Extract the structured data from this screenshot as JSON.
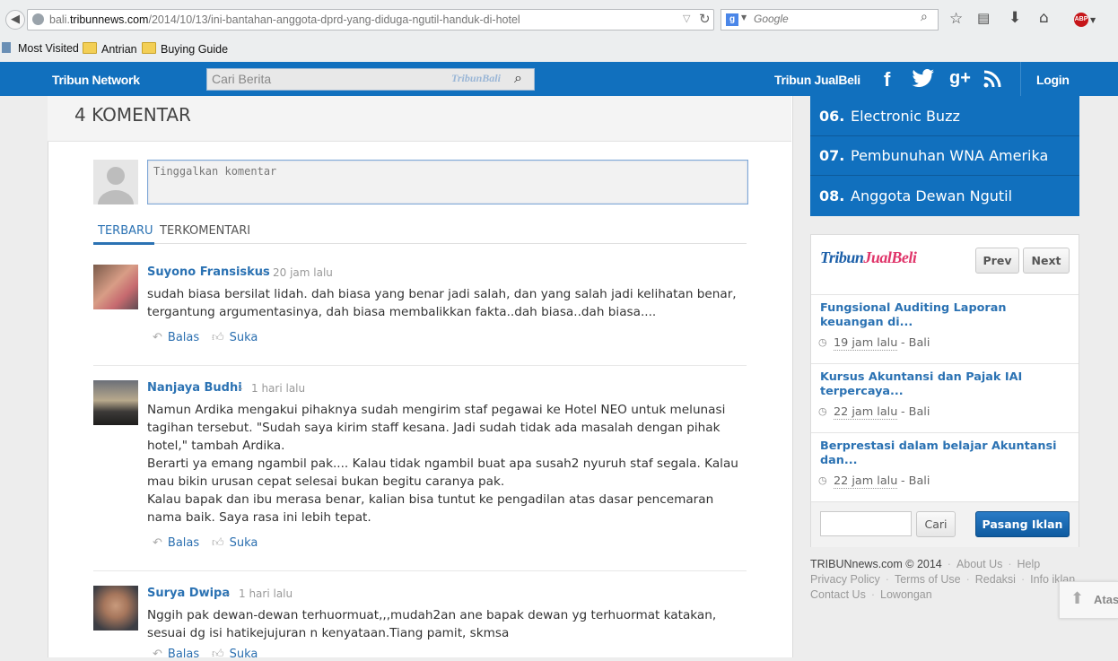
{
  "browser": {
    "url_prefix": "bali.",
    "url_host": "tribunnews.com",
    "url_path": "/2014/10/13/ini-bantahan-anggota-dprd-yang-diduga-ngutil-handuk-di-hotel",
    "search_placeholder": "Google",
    "bookmarks": [
      "Most Visited",
      "Antrian",
      "Buying Guide"
    ]
  },
  "header": {
    "network": "Tribun Network",
    "search_placeholder": "Cari Berita",
    "search_logo": "TribunBali",
    "jualbeli": "Tribun JualBeli",
    "login": "Login"
  },
  "comments": {
    "title": "4 KOMENTAR",
    "input_placeholder": "Tinggalkan komentar",
    "tabs": [
      "TERBARU",
      "TERKOMENTARI"
    ],
    "reply_label": "Balas",
    "like_label": "Suka",
    "items": [
      {
        "name": "Suyono Fransiskus",
        "time": "20 jam lalu",
        "text": "sudah biasa bersilat lidah. dah biasa yang benar jadi salah, dan yang salah jadi kelihatan benar, tergantung argumentasinya, dah biasa membalikkan fakta..dah biasa..dah biasa...."
      },
      {
        "name": "Nanjaya Budhi",
        "time": "1 hari lalu",
        "text": "Namun Ardika mengakui pihaknya sudah mengirim staf pegawai ke Hotel NEO untuk melunasi tagihan tersebut. \"Sudah saya kirim staff kesana. Jadi sudah tidak ada masalah dengan pihak hotel,\" tambah Ardika.\nBerarti ya emang ngambil pak.... Kalau tidak ngambil buat apa susah2 nyuruh staf segala. Kalau mau bikin urusan cepat selesai bukan begitu caranya pak.\nKalau bapak dan ibu merasa benar, kalian bisa tuntut ke pengadilan atas dasar pencemaran nama baik. Saya rasa ini lebih tepat."
      },
      {
        "name": "Surya Dwipa",
        "time": "1 hari lalu",
        "text": "Nggih pak dewan-dewan terhuormuat,,,mudah2an ane bapak dewan yg terhuormat katakan, sesuai dg isi hatikejujuran n kenyataan.Tiang pamit, skmsa"
      }
    ]
  },
  "sidebar": {
    "trending": [
      {
        "num": "06.",
        "label": "Electronic Buzz"
      },
      {
        "num": "07.",
        "label": "Pembunuhan WNA Amerika"
      },
      {
        "num": "08.",
        "label": "Anggota Dewan Ngutil"
      }
    ],
    "jualbeli": {
      "logo_a": "Tribun",
      "logo_b": "JualBeli",
      "prev": "Prev",
      "next": "Next",
      "items": [
        {
          "title": "Fungsional Auditing Laporan keuangan di...",
          "time": "19 jam lalu",
          "loc": "- Bali"
        },
        {
          "title": "Kursus Akuntansi dan Pajak IAI terpercaya...",
          "time": "22 jam lalu",
          "loc": "- Bali"
        },
        {
          "title": "Berprestasi dalam belajar Akuntansi dan...",
          "time": "22 jam lalu",
          "loc": "- Bali"
        }
      ],
      "search_button": "Cari",
      "ad_button": "Pasang Iklan"
    },
    "footer": {
      "copyright": "TRIBUNnews.com © 2014",
      "links_row1": [
        "About Us",
        "Help"
      ],
      "links_row2": [
        "Privacy Policy",
        "Terms of Use",
        "Redaksi",
        "Info iklan"
      ],
      "links_row3": [
        "Contact Us",
        "Lowongan"
      ]
    },
    "back_to_top": "Atas"
  },
  "colors": {
    "brand": "#1170be",
    "link": "#2b72b3"
  }
}
